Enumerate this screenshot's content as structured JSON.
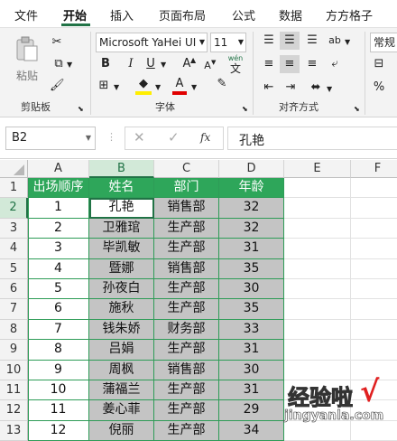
{
  "menu": {
    "tabs": [
      {
        "label": "文件",
        "active": false
      },
      {
        "label": "开始",
        "active": true
      },
      {
        "label": "插入",
        "active": false
      },
      {
        "label": "页面布局",
        "active": false
      },
      {
        "label": "公式",
        "active": false
      },
      {
        "label": "数据",
        "active": false
      },
      {
        "label": "方方格子",
        "active": false
      }
    ]
  },
  "ribbon": {
    "clipboard": {
      "paste_label": "粘贴",
      "group_label": "剪贴板"
    },
    "font": {
      "font_name": "Microsoft YaHei UI",
      "font_size": "11",
      "bold": "B",
      "italic": "I",
      "underline": "U",
      "grow": "A",
      "shrink": "A",
      "phonetic_top": "wén",
      "phonetic_bottom": "文",
      "group_label": "字体"
    },
    "alignment": {
      "group_label": "对齐方式"
    },
    "number": {
      "format": "常规"
    }
  },
  "formula_bar": {
    "cell_ref": "B2",
    "fx": "fx",
    "value": "孔艳"
  },
  "sheet": {
    "columns": [
      "A",
      "B",
      "C",
      "D",
      "E",
      "F"
    ],
    "selected_column": "B",
    "selected_row": "2",
    "row_numbers": [
      "1",
      "2",
      "3",
      "4",
      "5",
      "6",
      "7",
      "8",
      "9",
      "10",
      "11",
      "12",
      "13"
    ],
    "headers": [
      "出场顺序",
      "姓名",
      "部门",
      "年龄"
    ],
    "rows": [
      [
        "1",
        "孔艳",
        "销售部",
        "32"
      ],
      [
        "2",
        "卫雅琯",
        "生产部",
        "32"
      ],
      [
        "3",
        "毕凯敏",
        "生产部",
        "31"
      ],
      [
        "4",
        "暨娜",
        "销售部",
        "35"
      ],
      [
        "5",
        "孙夜白",
        "生产部",
        "30"
      ],
      [
        "6",
        "施秋",
        "生产部",
        "35"
      ],
      [
        "7",
        "钱朱娇",
        "财务部",
        "33"
      ],
      [
        "8",
        "吕娟",
        "生产部",
        "31"
      ],
      [
        "9",
        "周枫",
        "销售部",
        "30"
      ],
      [
        "10",
        "蒲福兰",
        "生产部",
        "31"
      ],
      [
        "11",
        "姜心菲",
        "生产部",
        "29"
      ],
      [
        "12",
        "倪丽",
        "生产部",
        "34"
      ]
    ]
  },
  "watermark": {
    "text": "经验啦",
    "check": "√",
    "url": "jingyanla.com"
  },
  "colors": {
    "accent": "#217346",
    "header_fill": "#2ea65a",
    "body_fill": "#c4c4c4"
  }
}
